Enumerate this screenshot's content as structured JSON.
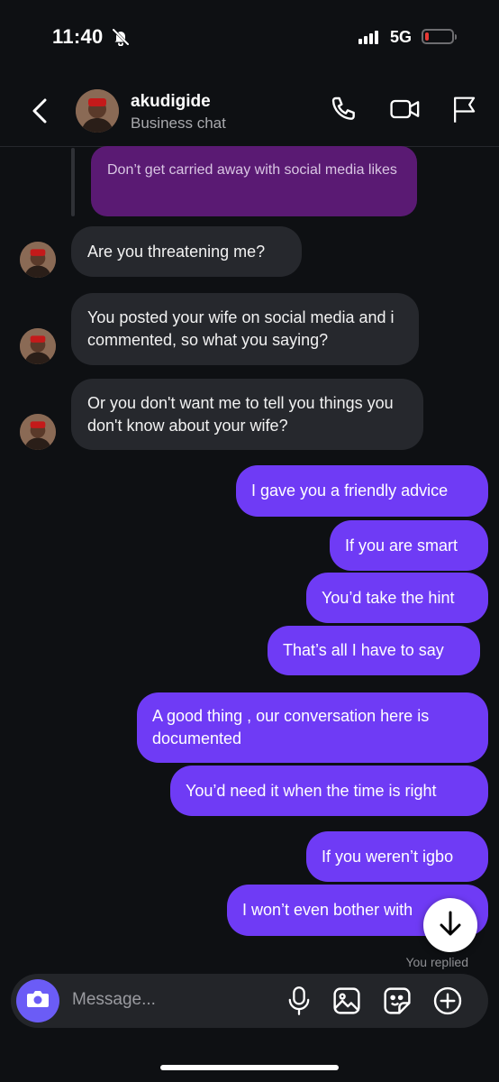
{
  "status_bar": {
    "time": "11:40",
    "network": "5G"
  },
  "header": {
    "name": "akudigide",
    "subtitle": "Business chat"
  },
  "quoted_message": "Don’t get carried away with social media likes",
  "incoming": [
    {
      "text": "Are you threatening me?"
    },
    {
      "text": "You posted your wife on social media and i commented, so what you saying?"
    },
    {
      "text": "Or you don't want me to tell you things you don't know about your wife?"
    }
  ],
  "outgoing": [
    {
      "text": "I gave you a friendly advice"
    },
    {
      "text": "If you are smart"
    },
    {
      "text": "You’d take the hint"
    },
    {
      "text": "That’s all I have to say"
    },
    {
      "text": "A good thing , our conversation here is documented"
    },
    {
      "text": "You’d need it when the time is right"
    },
    {
      "text": "If you weren’t igbo"
    },
    {
      "text": "I won’t even bother with"
    }
  ],
  "replied_label": "You replied",
  "composer": {
    "placeholder": "Message..."
  },
  "colors": {
    "outgoing_bubble": "#6f3bf5",
    "incoming_bubble": "#26282d",
    "quoted_bubble": "#5a1a73",
    "background": "#0e1013",
    "camera_button": "#6b5cf6"
  }
}
